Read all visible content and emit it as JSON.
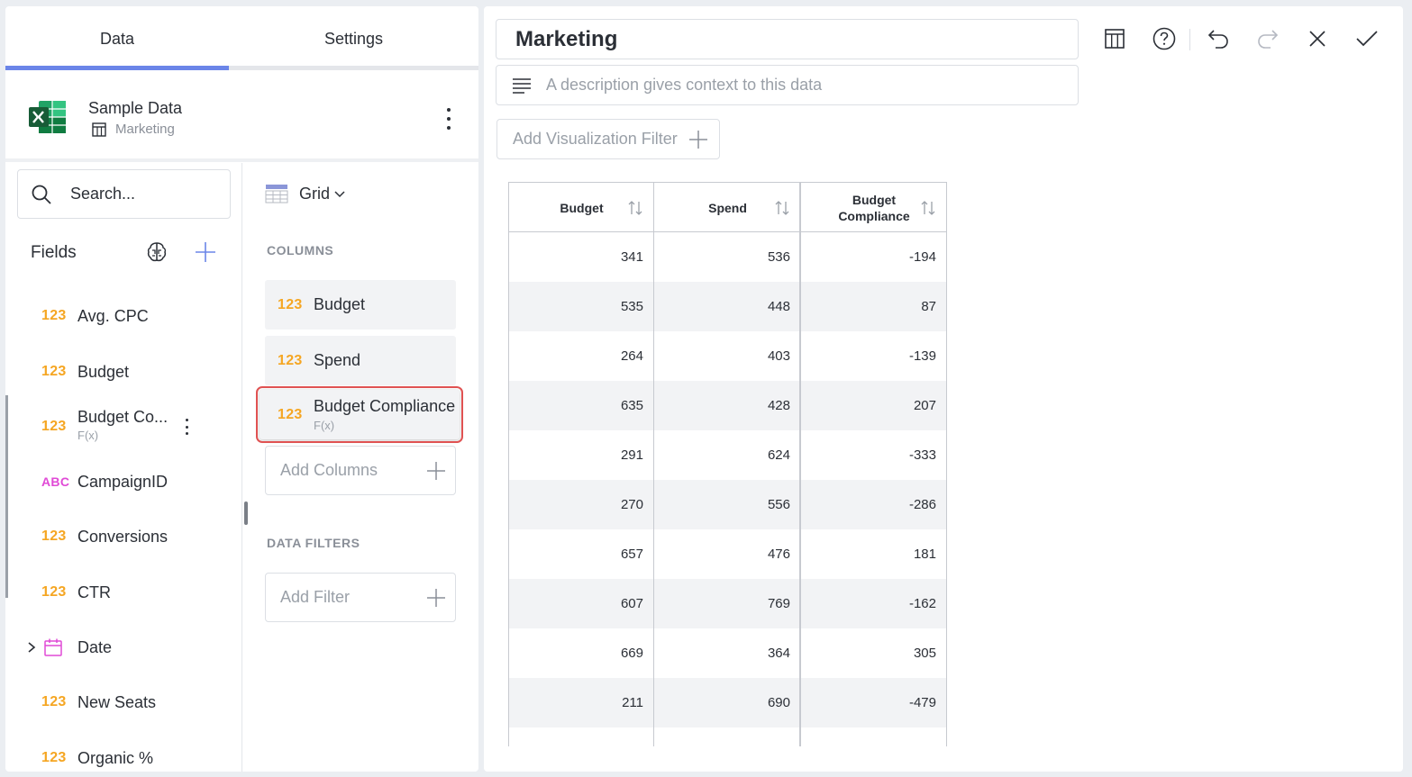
{
  "tabs": {
    "data": "Data",
    "settings": "Settings"
  },
  "source": {
    "name": "Sample Data",
    "sheet": "Marketing"
  },
  "search": {
    "placeholder": "Search..."
  },
  "fields": {
    "label": "Fields",
    "items": [
      {
        "type": "123",
        "name": "Avg. CPC"
      },
      {
        "type": "123",
        "name": "Budget"
      },
      {
        "type": "123",
        "name": "Budget Co...",
        "sub": "F(x)"
      },
      {
        "type": "ABC",
        "name": "CampaignID"
      },
      {
        "type": "123",
        "name": "Conversions"
      },
      {
        "type": "123",
        "name": "CTR"
      },
      {
        "type": "date",
        "name": "Date"
      },
      {
        "type": "123",
        "name": "New Seats"
      },
      {
        "type": "123",
        "name": "Organic %"
      }
    ]
  },
  "builder": {
    "viz_type": "Grid",
    "columns_title": "COLUMNS",
    "columns": [
      {
        "type": "123",
        "name": "Budget"
      },
      {
        "type": "123",
        "name": "Spend"
      },
      {
        "type": "123",
        "name": "Budget Compliance",
        "sub": "F(x)"
      }
    ],
    "add_columns": "Add Columns",
    "filters_title": "DATA FILTERS",
    "add_filter": "Add Filter"
  },
  "editor": {
    "title": "Marketing",
    "description_placeholder": "A description gives context to this data",
    "viz_filter": "Add Visualization Filter"
  },
  "table": {
    "headers": [
      "Budget",
      "Spend",
      "Budget\nCompliance"
    ],
    "rows": [
      [
        "341",
        "536",
        "-194"
      ],
      [
        "535",
        "448",
        "87"
      ],
      [
        "264",
        "403",
        "-139"
      ],
      [
        "635",
        "428",
        "207"
      ],
      [
        "291",
        "624",
        "-333"
      ],
      [
        "270",
        "556",
        "-286"
      ],
      [
        "657",
        "476",
        "181"
      ],
      [
        "607",
        "769",
        "-162"
      ],
      [
        "669",
        "364",
        "305"
      ],
      [
        "211",
        "690",
        "-479"
      ]
    ]
  },
  "colors": {
    "accent": "#6b85e8",
    "number_type": "#f5a623",
    "text_type": "#e04ad6",
    "excel_green": "#1f7a44",
    "selection_outline": "#e05252"
  }
}
